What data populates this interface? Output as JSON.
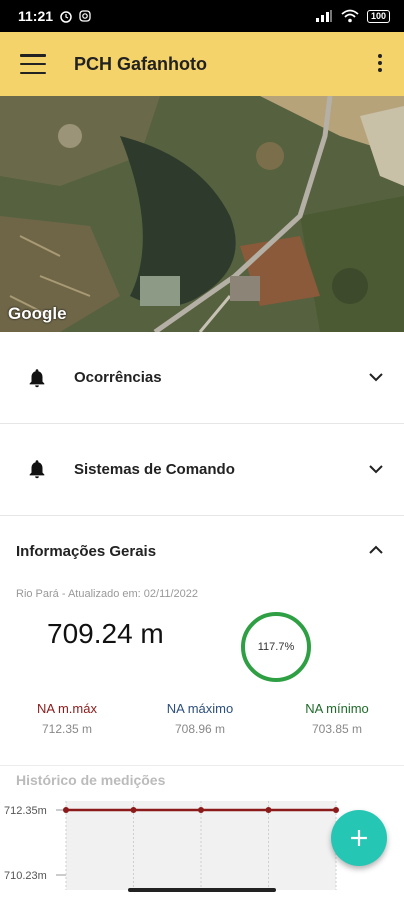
{
  "status": {
    "time": "11:21",
    "battery": "100"
  },
  "appbar": {
    "title": "PCH Gafanhoto"
  },
  "map": {
    "attribution": "Google"
  },
  "sections": [
    {
      "label": "Ocorrências"
    },
    {
      "label": "Sistemas de Comando"
    }
  ],
  "info": {
    "title": "Informações Gerais",
    "subtitle": "Rio Pará - Atualizado em: 02/11/2022",
    "value": "709.24 m",
    "gauge_label": "117.7%",
    "gauge_percent": 117.7,
    "na": [
      {
        "label": "NA m.máx",
        "value": "712.35 m",
        "color": "#8b1a1a"
      },
      {
        "label": "NA máximo",
        "value": "708.96 m",
        "color": "#2c4f7c"
      },
      {
        "label": "NA mínimo",
        "value": "703.85 m",
        "color": "#1f6b2a"
      }
    ]
  },
  "history": {
    "title": "Histórico de medições"
  },
  "chart_data": {
    "type": "line",
    "y_tick_labels": [
      "712.35m",
      "710.23m"
    ],
    "series": [
      {
        "values": [
          712.35,
          712.35,
          712.35,
          712.35,
          712.35
        ],
        "color": "#8b1a1a"
      }
    ]
  },
  "accent": {
    "fab": "#26c6b5",
    "appbar": "#f4d36a"
  }
}
